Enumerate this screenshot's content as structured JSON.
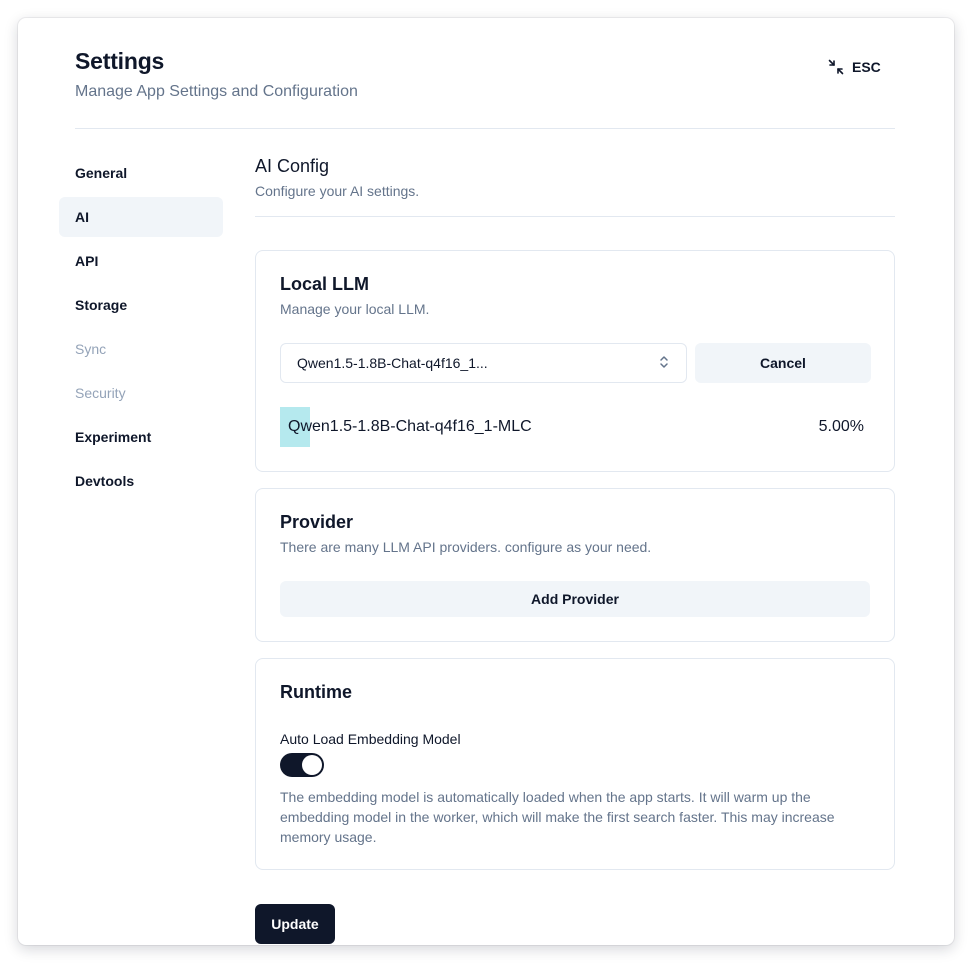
{
  "header": {
    "title": "Settings",
    "subtitle": "Manage App Settings and Configuration",
    "esc_label": "ESC",
    "esc_icon": "minimize-icon"
  },
  "sidebar": {
    "items": [
      {
        "label": "General",
        "state": "normal"
      },
      {
        "label": "AI",
        "state": "active"
      },
      {
        "label": "API",
        "state": "normal"
      },
      {
        "label": "Storage",
        "state": "normal"
      },
      {
        "label": "Sync",
        "state": "disabled"
      },
      {
        "label": "Security",
        "state": "disabled"
      },
      {
        "label": "Experiment",
        "state": "normal"
      },
      {
        "label": "Devtools",
        "state": "normal"
      }
    ]
  },
  "main": {
    "title": "AI Config",
    "subtitle": "Configure your AI settings."
  },
  "local_llm": {
    "title": "Local LLM",
    "description": "Manage your local LLM.",
    "selected_model": "Qwen1.5-1.8B-Chat-q4f16_1...",
    "select_icon": "chevron-up-down-icon",
    "cancel_label": "Cancel",
    "download_model": "Qwen1.5-1.8B-Chat-q4f16_1-MLC",
    "download_percent_text": "5.00%",
    "download_progress": 0.05
  },
  "provider": {
    "title": "Provider",
    "description": "There are many LLM API providers. configure as your need.",
    "add_label": "Add Provider"
  },
  "runtime": {
    "title": "Runtime",
    "auto_load_label": "Auto Load Embedding Model",
    "auto_load_enabled": true,
    "auto_load_help": "The embedding model is automatically loaded when the app starts. It will warm up the embedding model in the worker, which will make the first search faster. This may increase memory usage."
  },
  "actions": {
    "update_label": "Update"
  },
  "colors": {
    "primary": "#0f172a",
    "muted": "#64748b",
    "secondary_bg": "#f1f5f9",
    "border": "#e2e8f0",
    "progress": "#b5e9ee"
  }
}
